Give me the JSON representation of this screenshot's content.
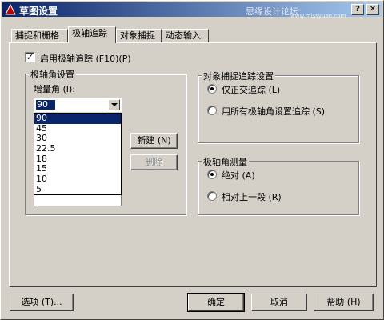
{
  "window": {
    "title": "草图设置",
    "watermark": "思缘设计论坛",
    "watermark_url": "www.missyuan.com",
    "help_btn": "?",
    "close_btn": "✕"
  },
  "tabs": [
    {
      "label": "捕捉和栅格",
      "active": false
    },
    {
      "label": "极轴追踪",
      "active": true
    },
    {
      "label": "对象捕捉",
      "active": false
    },
    {
      "label": "动态输入",
      "active": false
    }
  ],
  "polar": {
    "enable_label": "启用极轴追踪 (F10)(P)",
    "enabled": true,
    "angle_group_label": "极轴角设置",
    "increment_label": "增量角 (I):",
    "increment_value": "90",
    "increment_options": [
      "90",
      "45",
      "30",
      "22.5",
      "18",
      "15",
      "10",
      "5"
    ],
    "new_button": "新建 (N)",
    "delete_button": "删除"
  },
  "snap_tracking": {
    "group_label": "对象捕捉追踪设置",
    "orthogonal_label": "仅正交追踪 (L)",
    "all_angles_label": "用所有极轴角设置追踪 (S)",
    "selected": "orthogonal"
  },
  "measurement": {
    "group_label": "极轴角测量",
    "absolute_label": "绝对 (A)",
    "relative_label": "相对上一段 (R)",
    "selected": "absolute"
  },
  "footer": {
    "options_button": "选项 (T)...",
    "ok_button": "确定",
    "cancel_button": "取消",
    "help_button": "帮助 (H)"
  },
  "colors": {
    "face": "#d4d0c8",
    "title_start": "#0a246a",
    "title_end": "#a6caf0",
    "selection": "#0a246a"
  }
}
